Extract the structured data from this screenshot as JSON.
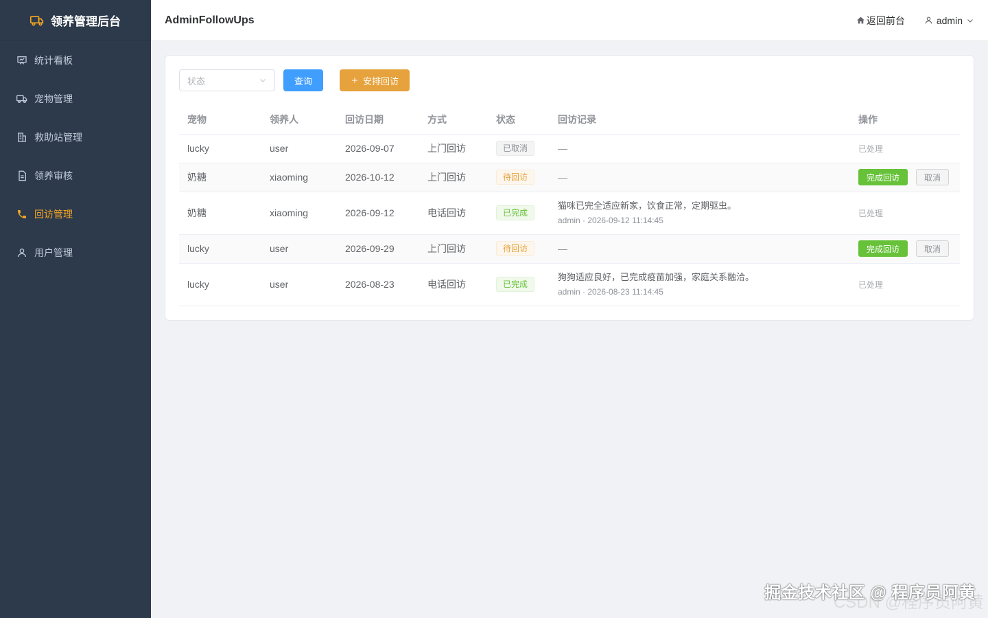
{
  "sidebar": {
    "brand": "领养管理后台",
    "items": [
      {
        "label": "统计看板",
        "icon": "chart-board-icon",
        "active": false
      },
      {
        "label": "宠物管理",
        "icon": "truck-icon",
        "active": false
      },
      {
        "label": "救助站管理",
        "icon": "building-icon",
        "active": false
      },
      {
        "label": "领养审核",
        "icon": "document-icon",
        "active": false
      },
      {
        "label": "回访管理",
        "icon": "phone-icon",
        "active": true
      },
      {
        "label": "用户管理",
        "icon": "user-icon",
        "active": false
      }
    ]
  },
  "header": {
    "title": "AdminFollowUps",
    "back_label": "返回前台",
    "user_label": "admin"
  },
  "toolbar": {
    "status_placeholder": "状态",
    "query_label": "查询",
    "schedule_label": "安排回访"
  },
  "table": {
    "columns": [
      "宠物",
      "领养人",
      "回访日期",
      "方式",
      "状态",
      "回访记录",
      "操作"
    ],
    "rows": [
      {
        "pet": "lucky",
        "adopter": "user",
        "date": "2026-09-07",
        "method": "上门回访",
        "status": "已取消",
        "record": "—",
        "meta": "",
        "action": "已处理"
      },
      {
        "pet": "奶糖",
        "adopter": "xiaoming",
        "date": "2026-10-12",
        "method": "上门回访",
        "status": "待回访",
        "record": "—",
        "meta": "",
        "complete": "完成回访",
        "cancel": "取消"
      },
      {
        "pet": "奶糖",
        "adopter": "xiaoming",
        "date": "2026-09-12",
        "method": "电话回访",
        "status": "已完成",
        "record": "猫咪已完全适应新家，饮食正常，定期驱虫。",
        "meta": "admin · 2026-09-12 11:14:45",
        "action": "已处理"
      },
      {
        "pet": "lucky",
        "adopter": "user",
        "date": "2026-09-29",
        "method": "上门回访",
        "status": "待回访",
        "record": "—",
        "meta": "",
        "complete": "完成回访",
        "cancel": "取消"
      },
      {
        "pet": "lucky",
        "adopter": "user",
        "date": "2026-08-23",
        "method": "电话回访",
        "status": "已完成",
        "record": "狗狗适应良好，已完成疫苗加强，家庭关系融洽。",
        "meta": "admin · 2026-08-23 11:14:45",
        "action": "已处理"
      }
    ]
  },
  "watermark": {
    "line1": "掘金技术社区 @ 程序员阿黄",
    "line2": "CSDN @程序员阿黄"
  }
}
